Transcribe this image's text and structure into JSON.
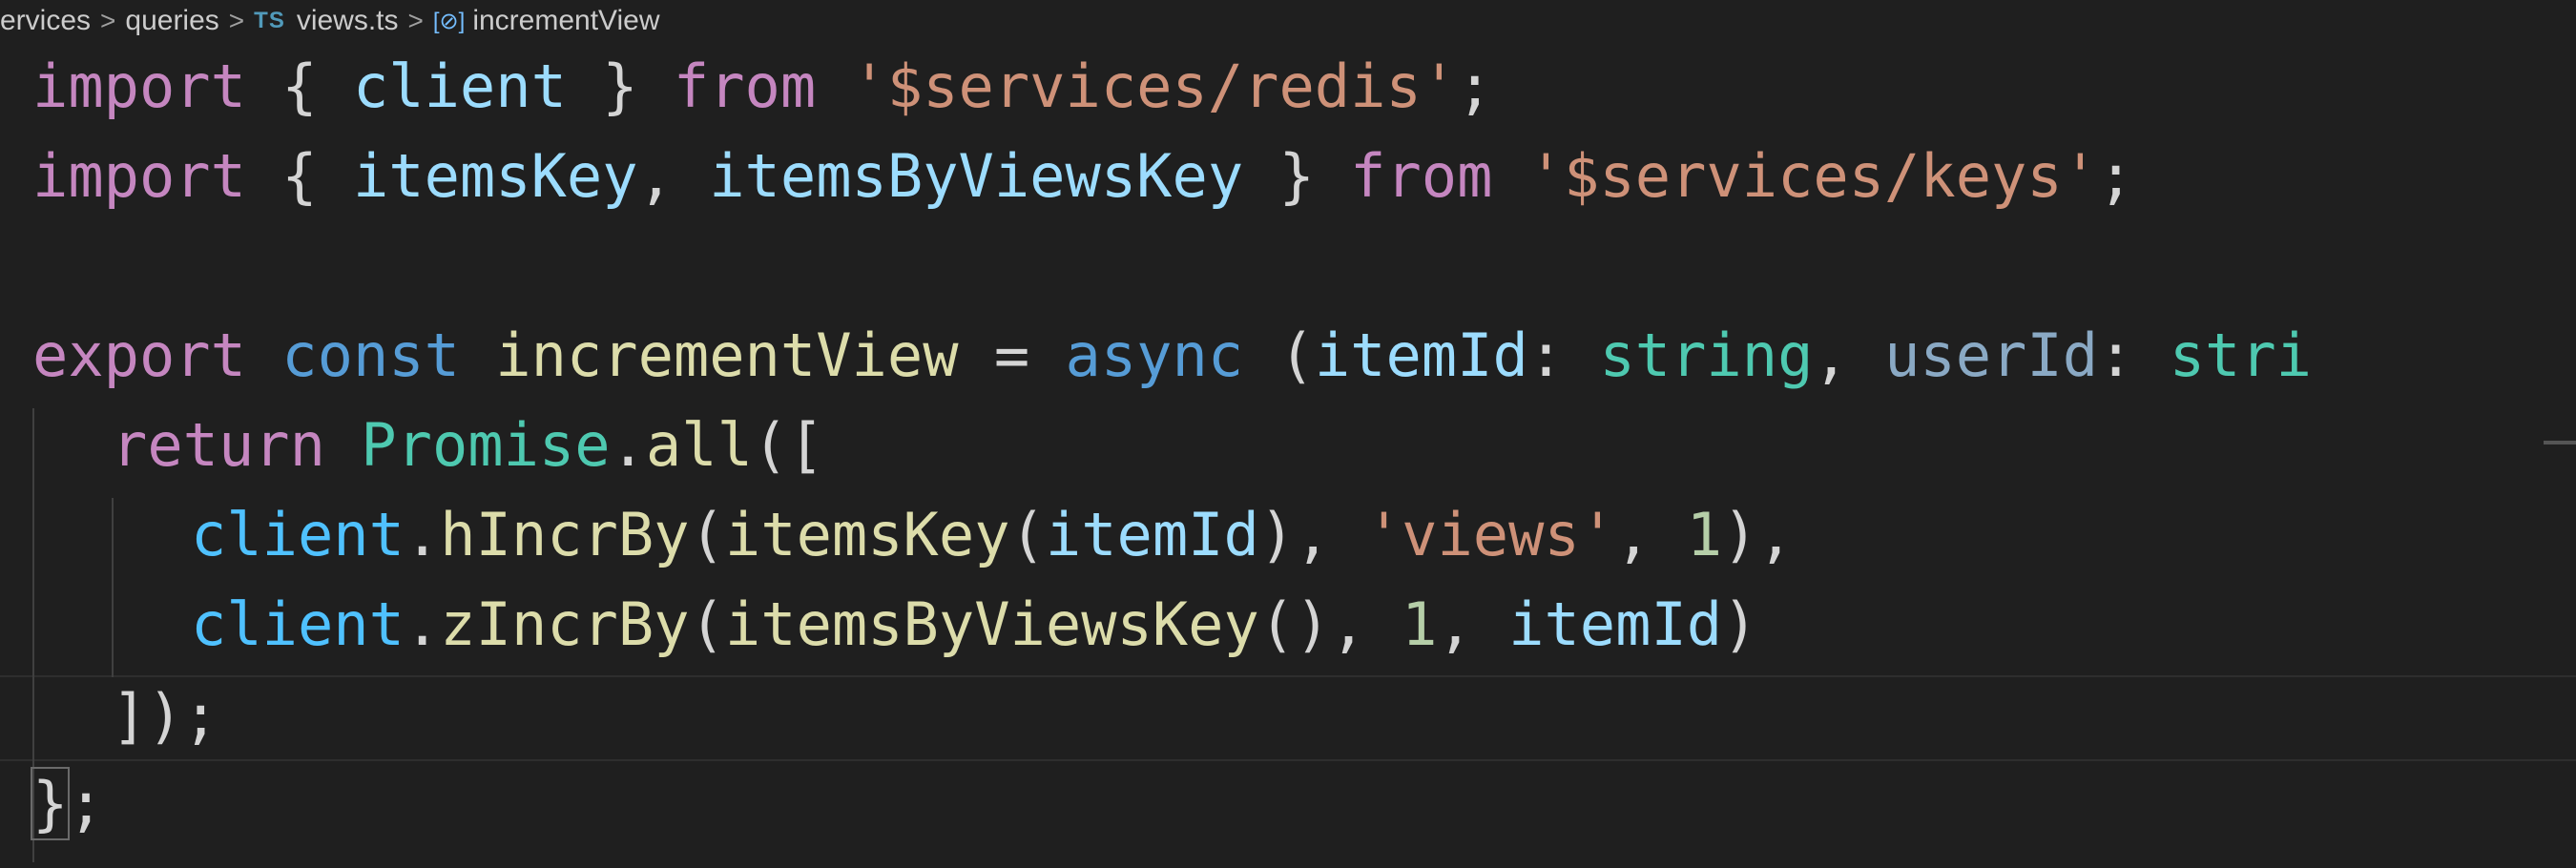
{
  "breadcrumb": {
    "items": [
      {
        "label": "ervices",
        "icon": null
      },
      {
        "label": "queries",
        "icon": null
      },
      {
        "label": "views.ts",
        "icon": "TS"
      },
      {
        "label": "incrementView",
        "icon": "[⊘]"
      }
    ],
    "separator": ">"
  },
  "code": {
    "line1": {
      "t1": "import",
      "t2": " { ",
      "t3": "client",
      "t4": " } ",
      "t5": "from",
      "t6": " ",
      "t7": "'$services/redis'",
      "t8": ";"
    },
    "line2": {
      "t1": "import",
      "t2": " { ",
      "t3": "itemsKey",
      "t4": ", ",
      "t5": "itemsByViewsKey",
      "t6": " } ",
      "t7": "from",
      "t8": " ",
      "t9": "'$services/keys'",
      "t10": ";"
    },
    "line4": {
      "t1": "export",
      "t2": " ",
      "t3": "const",
      "t4": " ",
      "t5": "incrementView",
      "t6": " = ",
      "t7": "async",
      "t8": " (",
      "t9": "itemId",
      "t10": ": ",
      "t11": "string",
      "t12": ", ",
      "t13": "userId",
      "t14": ": ",
      "t15": "stri"
    },
    "line5": {
      "t1": "return",
      "t2": " ",
      "t3": "Promise",
      "t4": ".",
      "t5": "all",
      "t6": "(["
    },
    "line6": {
      "t1": "client",
      "t2": ".",
      "t3": "hIncrBy",
      "t4": "(",
      "t5": "itemsKey",
      "t6": "(",
      "t7": "itemId",
      "t8": "), ",
      "t9": "'views'",
      "t10": ", ",
      "t11": "1",
      "t12": "),"
    },
    "line7": {
      "t1": "client",
      "t2": ".",
      "t3": "zIncrBy",
      "t4": "(",
      "t5": "itemsByViewsKey",
      "t6": "(), ",
      "t7": "1",
      "t8": ", ",
      "t9": "itemId",
      "t10": ")"
    },
    "line8": {
      "t1": "]);"
    },
    "line9": {
      "t1": "}",
      "t2": ";"
    }
  },
  "colors": {
    "background": "#1f1f1f",
    "keyword_control": "#c586c0",
    "keyword": "#569cd6",
    "variable": "#9cdcfe",
    "function": "#dcdcaa",
    "string": "#ce9178",
    "type": "#4ec9b0",
    "number": "#b5cea8"
  }
}
